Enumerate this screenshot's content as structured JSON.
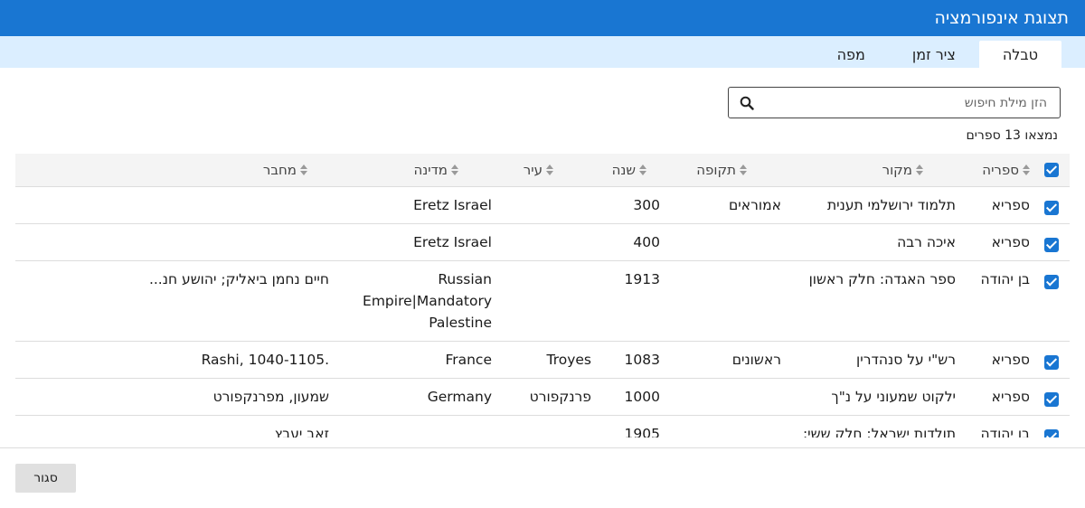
{
  "window": {
    "title": "תצוגת אינפורמציה"
  },
  "tabs": [
    {
      "label": "טבלה",
      "active": true
    },
    {
      "label": "ציר זמן",
      "active": false
    },
    {
      "label": "מפה",
      "active": false
    }
  ],
  "search": {
    "placeholder": "הזן מילת חיפוש",
    "value": ""
  },
  "results": {
    "count_text": "נמצאו 13 ספרים"
  },
  "table": {
    "columns": [
      "ספריה",
      "מקור",
      "תקופה",
      "שנה",
      "עיר",
      "מדינה",
      "מחבר"
    ],
    "rows": [
      {
        "library": "ספריא",
        "source": "תלמוד ירושלמי תענית",
        "period": "אמוראים",
        "year": "300",
        "city": "",
        "country": "Eretz Israel",
        "author": ""
      },
      {
        "library": "ספריא",
        "source": "איכה רבה",
        "period": "",
        "year": "400",
        "city": "",
        "country": "Eretz Israel",
        "author": ""
      },
      {
        "library": "בן יהודה",
        "source": "ספר האגדה: חלק ראשון",
        "period": "",
        "year": "1913",
        "city": "",
        "country": "Russian Empire|Mandatory Palestine",
        "author": "חיים נחמן ביאליק; יהושע חנ..."
      },
      {
        "library": "ספריא",
        "source": "רש\"י על סנהדרין",
        "period": "ראשונים",
        "year": "1083",
        "city": "Troyes",
        "country": "France",
        "author": "Rashi, 1040-1105."
      },
      {
        "library": "ספריא",
        "source": "ילקוט שמעוני על נ\"ך",
        "period": "",
        "year": "1000",
        "city": "פרנקפורט",
        "country": "Germany",
        "author": "שמעון, מפרנקפורט"
      },
      {
        "library": "בן יהודה",
        "source": "תולדות ישראל: חלק ששי: מוצא דבר",
        "period": "",
        "year": "1905",
        "city": "",
        "country": "",
        "author": "זאב יעבץ"
      }
    ]
  },
  "footer": {
    "close_label": "סגור"
  },
  "colors": {
    "accent": "#1976d2",
    "tabbar": "#dbeeff"
  }
}
